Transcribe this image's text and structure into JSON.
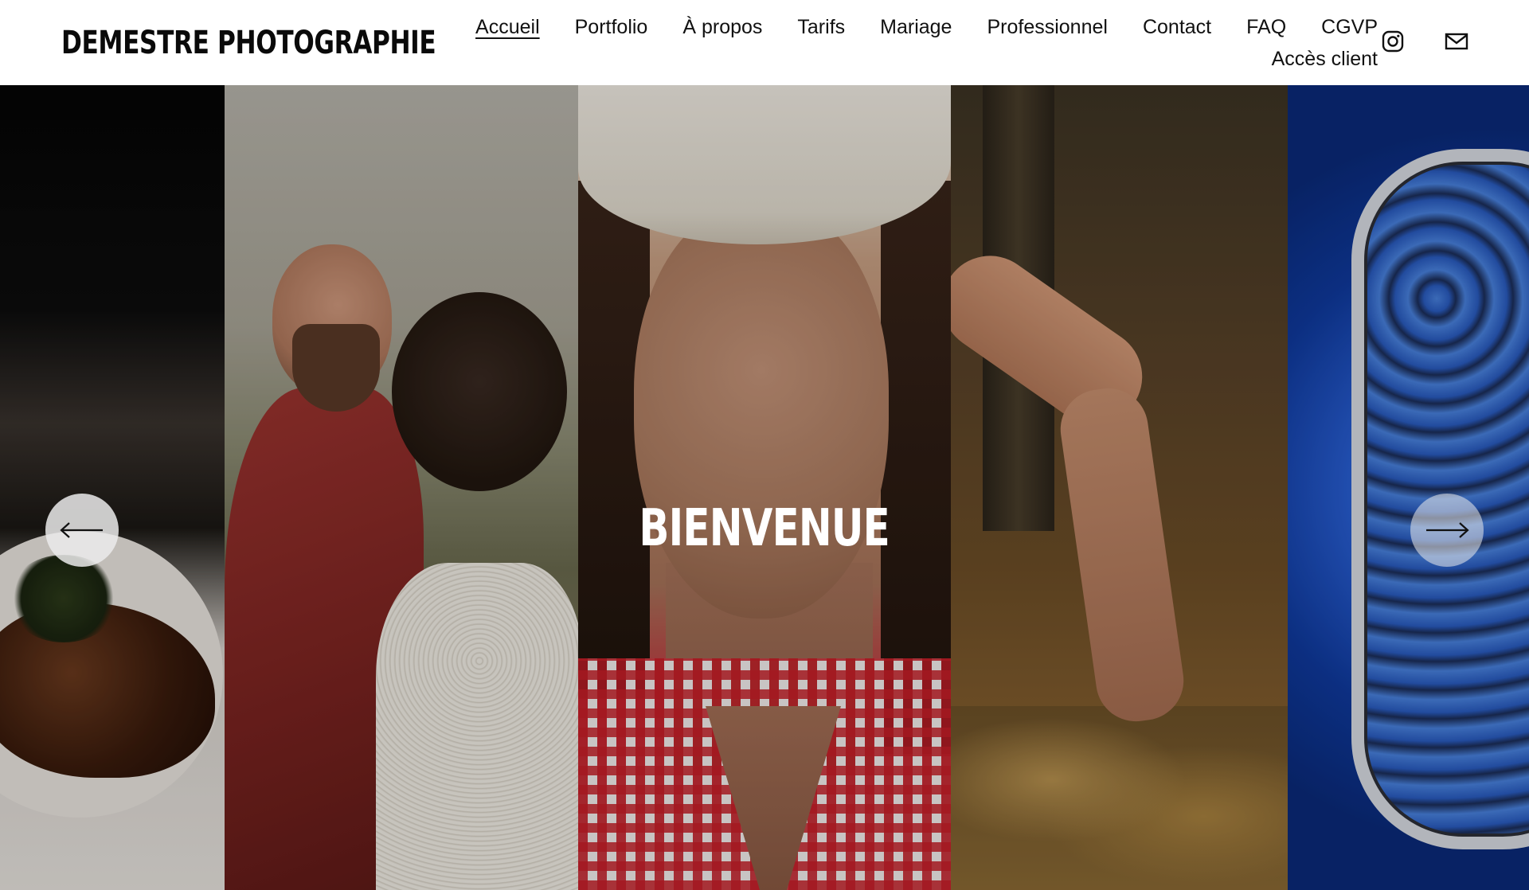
{
  "header": {
    "logo": "DEMESTRE PHOTOGRAPHIE",
    "nav": [
      {
        "label": "Accueil",
        "active": true
      },
      {
        "label": "Portfolio"
      },
      {
        "label": "À propos"
      },
      {
        "label": "Tarifs"
      },
      {
        "label": "Mariage"
      },
      {
        "label": "Professionnel"
      },
      {
        "label": "Contact"
      },
      {
        "label": "FAQ"
      },
      {
        "label": "CGVP"
      },
      {
        "label": "Accès client"
      }
    ],
    "icons": [
      "instagram-icon",
      "mail-icon"
    ]
  },
  "hero": {
    "title": "BIENVENUE",
    "slides": [
      "food",
      "wedding-couple",
      "portrait-cowboy-hat",
      "arm-autumn-leaves",
      "blue-gem-ring"
    ]
  },
  "colors": {
    "background": "#ffffff",
    "text": "#111111",
    "hero_text": "#ffffff",
    "arrow_bg": "#ebebeb"
  }
}
